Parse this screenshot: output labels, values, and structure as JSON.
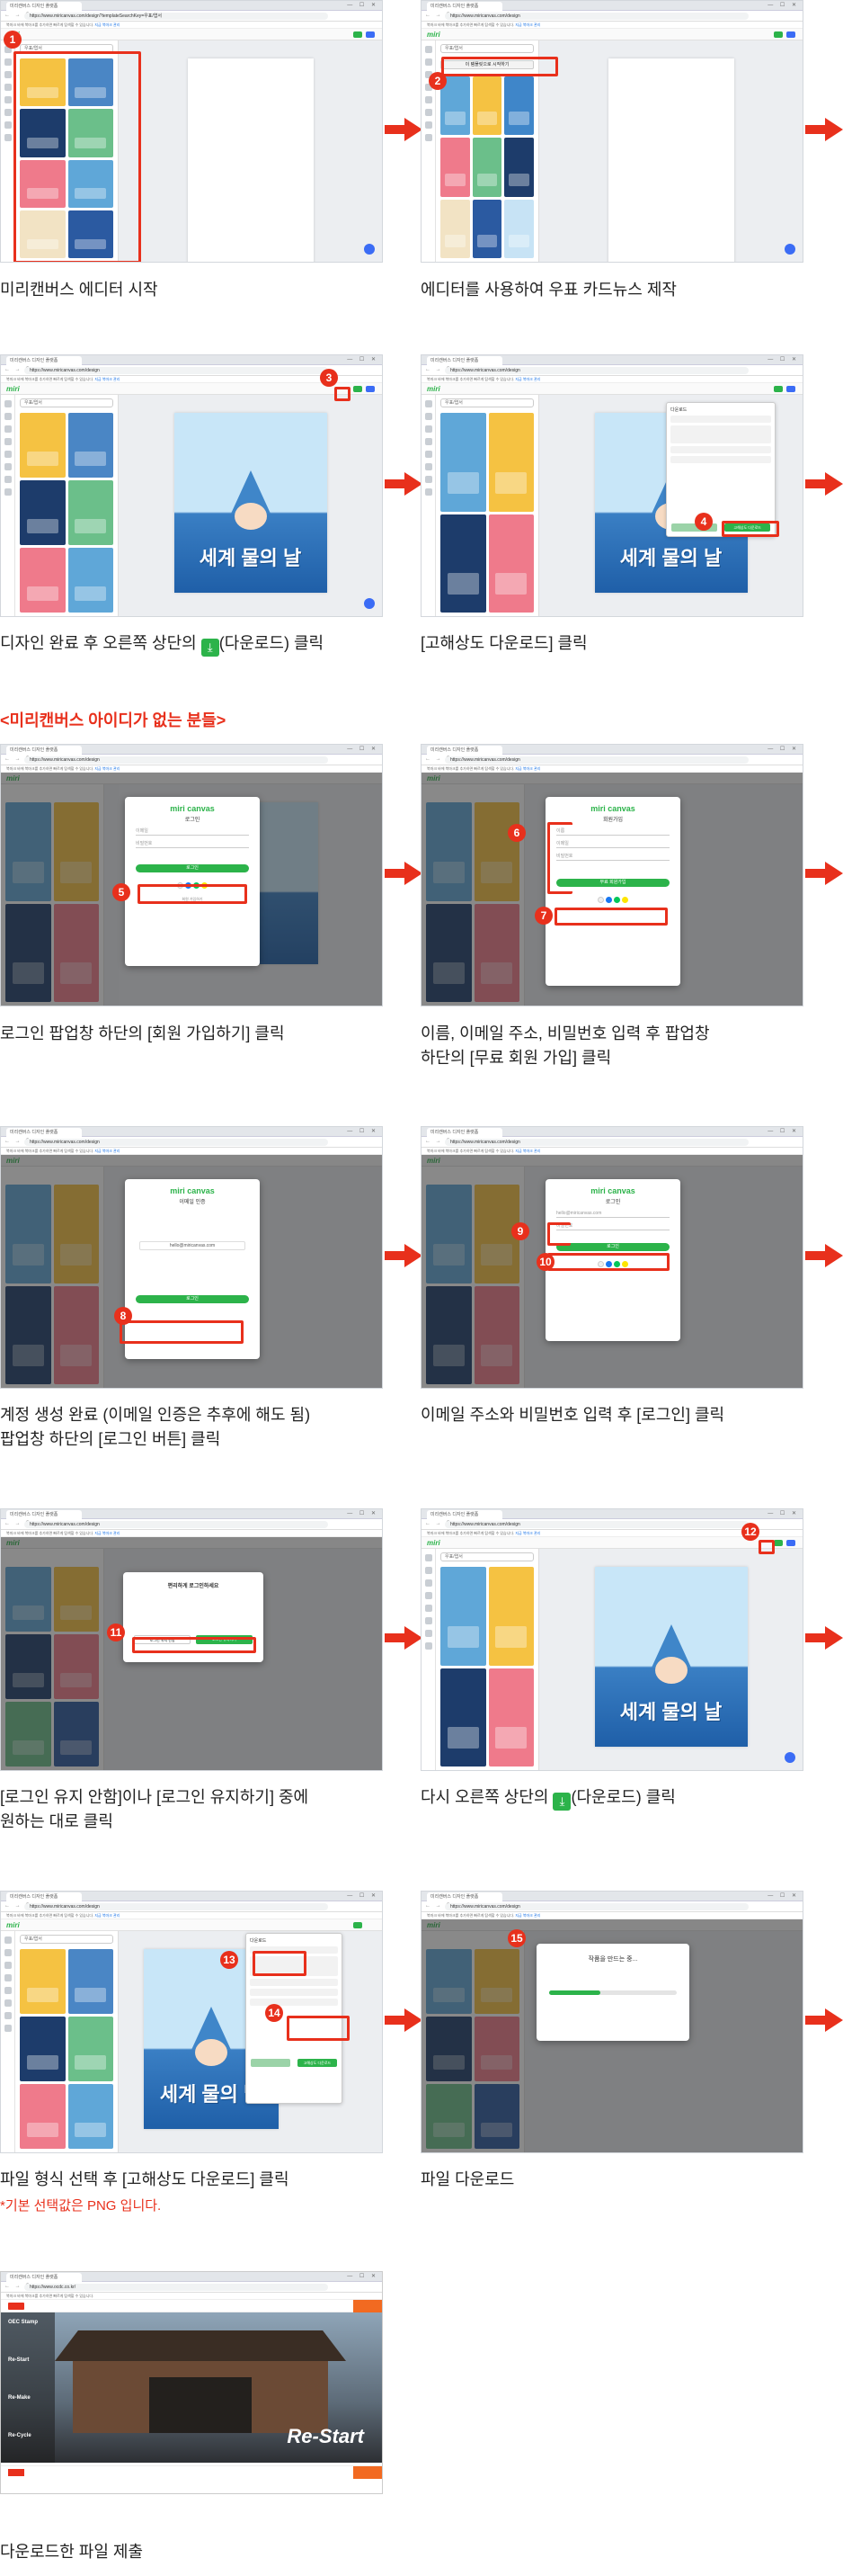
{
  "browser": {
    "tab_title": "미리캔버스 디자인 플랫폼",
    "window_controls": "— ☐ ✕",
    "nav_buttons": "← → C",
    "url_step1": "https://www.miricanvas.com/design?templateSearchKey=우표/엽서",
    "url_default": "https://www.miricanvas.com/design",
    "url_final": "https://www.ocdc.co.kr/",
    "bookmark_text": "북마크 바에 북마크를 추가하면 빠르게 탐색할 수 있습니다.",
    "bookmark_link": "지금 북마크 관리"
  },
  "editor": {
    "logo": "miri",
    "search_placeholder": "우표/엽서",
    "artwork_title": "세계 물의 날"
  },
  "panel_button": "이 템플릿으로 시작하기",
  "modals": {
    "brand": "miri canvas",
    "login_title": "로그인",
    "signup_title": "회원가입",
    "verify_title": "이메일 인증",
    "email_field": "이메일",
    "password_field": "비밀번호",
    "name_field": "이름",
    "login_btn": "로그인",
    "signup_btn": "무료 회원가입",
    "email_value": "hello@miricanvas.com",
    "signup_link": "회원 가입하기",
    "keep_prompt": "편리하게 로그인하세요",
    "keep_no": "로그인 유지 안함",
    "keep_yes": "로그인 유지하기",
    "download_title": "다운로드",
    "hq_download": "고해상도 다운로드",
    "progress_title": "작품을 만드는 중..."
  },
  "steps": [
    {
      "n": "1",
      "caption": "미리캔버스 에디터 시작"
    },
    {
      "n": "2",
      "caption": "에디터를 사용하여 우표 카드뉴스 제작"
    },
    {
      "n": "3",
      "caption_pre": "디자인 완료 후 오른쪽 상단의 ",
      "caption_post": "(다운로드) 클릭"
    },
    {
      "n": "4",
      "caption": "[고해상도 다운로드] 클릭"
    },
    {
      "n": "5",
      "caption": "로그인 팝업창 하단의 [회원 가입하기] 클릭"
    },
    {
      "n": "6",
      "n2": "7",
      "caption_l1": "이름, 이메일 주소, 비밀번호 입력 후 팝업창",
      "caption_l2": "하단의 [무료 회원 가입] 클릭"
    },
    {
      "n": "8",
      "caption_l1": "계정 생성 완료 (이메일 인증은 추후에 해도 됨)",
      "caption_l2": "팝업창 하단의 [로그인 버튼] 클릭"
    },
    {
      "n": "9",
      "n2": "10",
      "caption": "이메일 주소와 비밀번호 입력 후 [로그인] 클릭"
    },
    {
      "n": "11",
      "caption_l1": "[로그인 유지 안함]이나 [로그인 유지하기] 중에",
      "caption_l2": "원하는 대로 클릭"
    },
    {
      "n": "12",
      "caption_pre": "다시 오른쪽 상단의 ",
      "caption_post": "(다운로드) 클릭"
    },
    {
      "n": "13",
      "n2": "14",
      "caption": "파일 형식 선택 후 [고해상도 다운로드] 클릭",
      "note": "*기본 선택값은 PNG 입니다."
    },
    {
      "n": "15",
      "caption": "파일 다운로드"
    },
    {
      "caption": "다운로드한 파일 제출"
    }
  ],
  "section_heading": "<미리캔버스 아이디가 없는 분들>",
  "download_icon": "download-icon",
  "homepage": {
    "hero_title": "Re-Start",
    "side_items": [
      "OEC Stamp",
      "Re-Start",
      "Re-Make",
      "Re-Cycle"
    ]
  },
  "colors": {
    "accent": "#e8301c",
    "brand_green": "#2cb34a"
  }
}
